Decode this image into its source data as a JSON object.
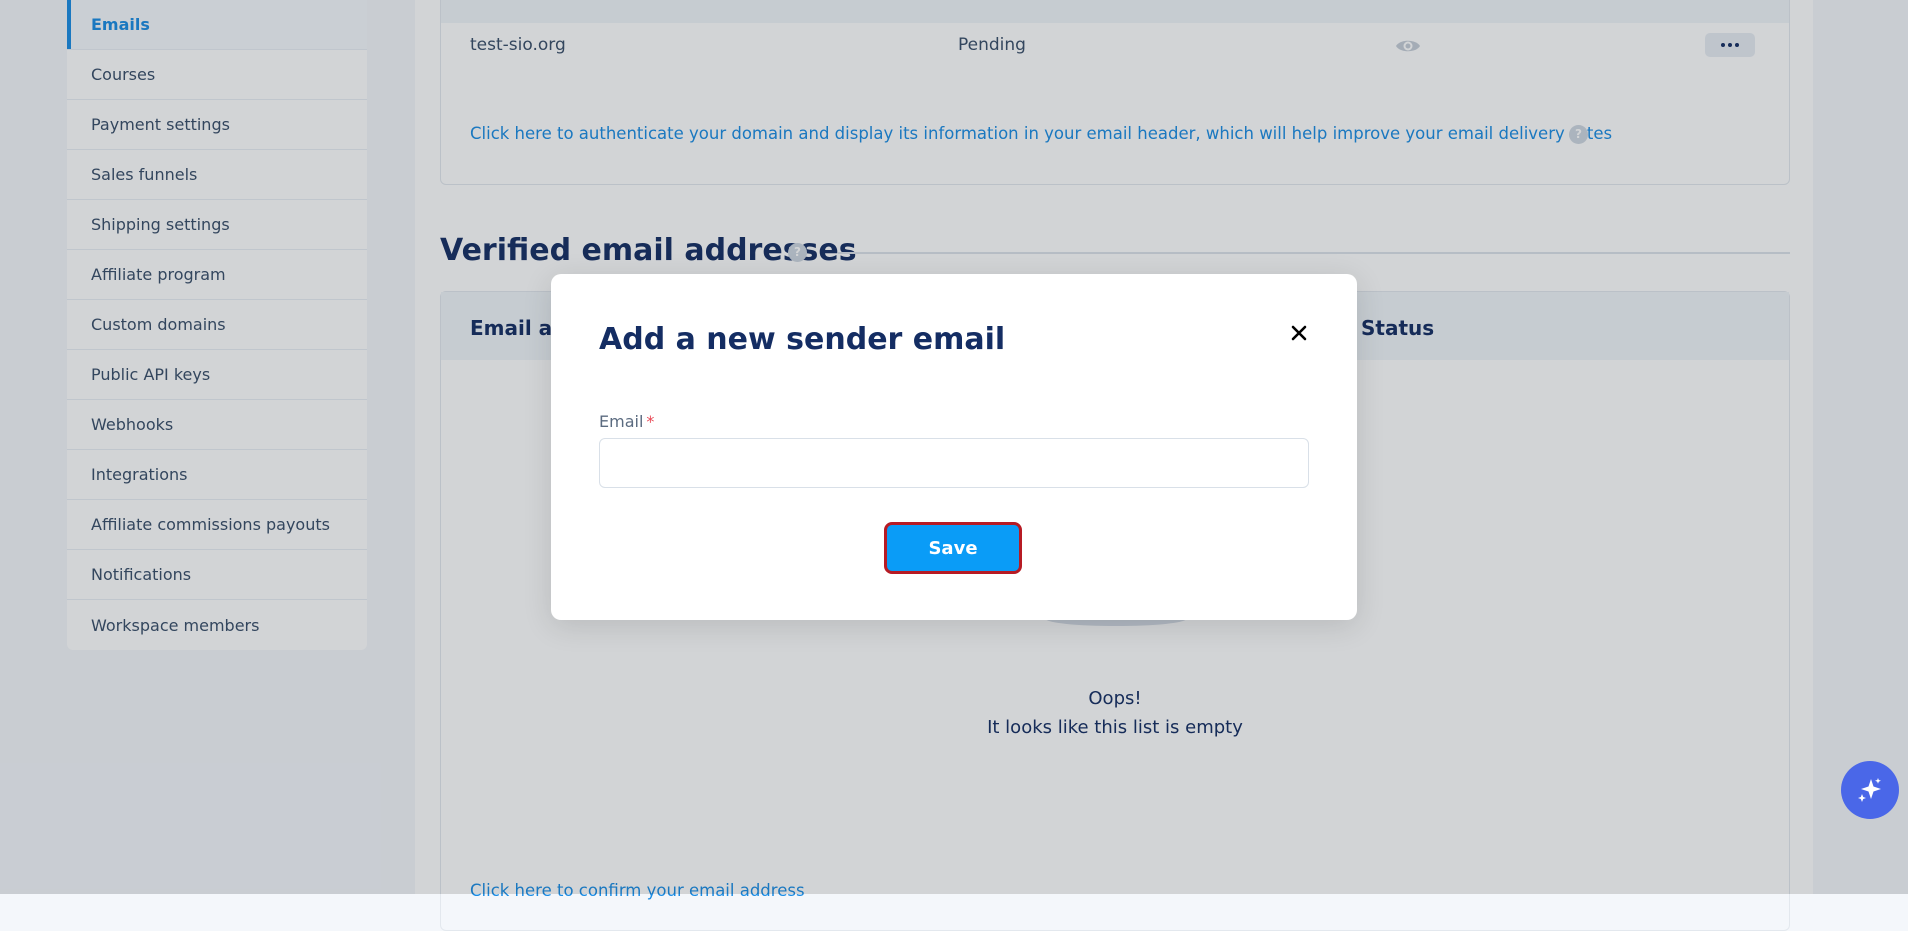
{
  "sidebar": {
    "items": [
      {
        "label": "Emails",
        "active": true
      },
      {
        "label": "Courses"
      },
      {
        "label": "Payment settings"
      },
      {
        "label": "Sales funnels"
      },
      {
        "label": "Shipping settings"
      },
      {
        "label": "Affiliate program"
      },
      {
        "label": "Custom domains"
      },
      {
        "label": "Public API keys"
      },
      {
        "label": "Webhooks"
      },
      {
        "label": "Integrations"
      },
      {
        "label": "Affiliate commissions payouts"
      },
      {
        "label": "Notifications"
      },
      {
        "label": "Workspace members"
      }
    ]
  },
  "domains": {
    "row": {
      "domain": "test-sio.org",
      "status": "Pending"
    },
    "authenticate_link": "Click here to authenticate your domain and display its information in your email header, which will help improve your email delivery rates"
  },
  "verified": {
    "title": "Verified email addresses",
    "columns": [
      "Email ad",
      "Status"
    ],
    "empty_line1": "Oops!",
    "empty_line2": "It looks like this list is empty",
    "confirm_link": "Click here to confirm your email address"
  },
  "help_icon_glyph": "?",
  "modal": {
    "title": "Add a new sender email",
    "email_label": "Email",
    "required_mark": "*",
    "email_value": "",
    "save_label": "Save"
  },
  "colors": {
    "accent": "#1a8ce4",
    "save_button": "#0a9cf7",
    "save_border": "#b71b24",
    "title": "#142d63",
    "chat_fab": "#4a67e8"
  }
}
